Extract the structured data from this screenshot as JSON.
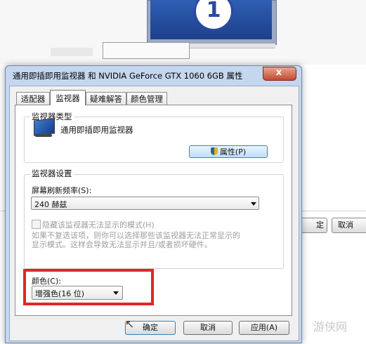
{
  "dialog": {
    "title": "通用即插即用监视器 和 NVIDIA GeForce GTX 1060 6GB 属性",
    "close_glyph": "x"
  },
  "tabs": [
    {
      "label": "适配器"
    },
    {
      "label": "监视器"
    },
    {
      "label": "疑难解答"
    },
    {
      "label": "颜色管理"
    }
  ],
  "monitor_type": {
    "group_label": "监视器类型",
    "monitor_name": "通用即插即用监视器",
    "properties_button": "属性(P)"
  },
  "monitor_settings": {
    "group_label": "监视器设置",
    "refresh_label": "屏幕刷新频率(S):",
    "refresh_value": "240 赫兹",
    "hide_modes_label": "隐藏该监视器无法显示的模式(H)",
    "hide_modes_desc_line1": "如果不复选该项，则你可以选择那些该监视器无法正常显示的",
    "hide_modes_desc_line2": "显示模式。这样会导致无法显示并且/或者损坏硬件。"
  },
  "colors": {
    "label": "颜色(C):",
    "value": "增强色(16 位)"
  },
  "buttons": {
    "ok": "确定",
    "cancel": "取消",
    "apply": "应用(A)"
  },
  "background_window": {
    "monitor_number": "1",
    "ok_fragment": "定",
    "cancel_fragment": "取消"
  },
  "watermark": "游侠网",
  "colors_palette": {
    "highlight": "#e0262a",
    "dialog_frame": "#c4d7ee"
  }
}
